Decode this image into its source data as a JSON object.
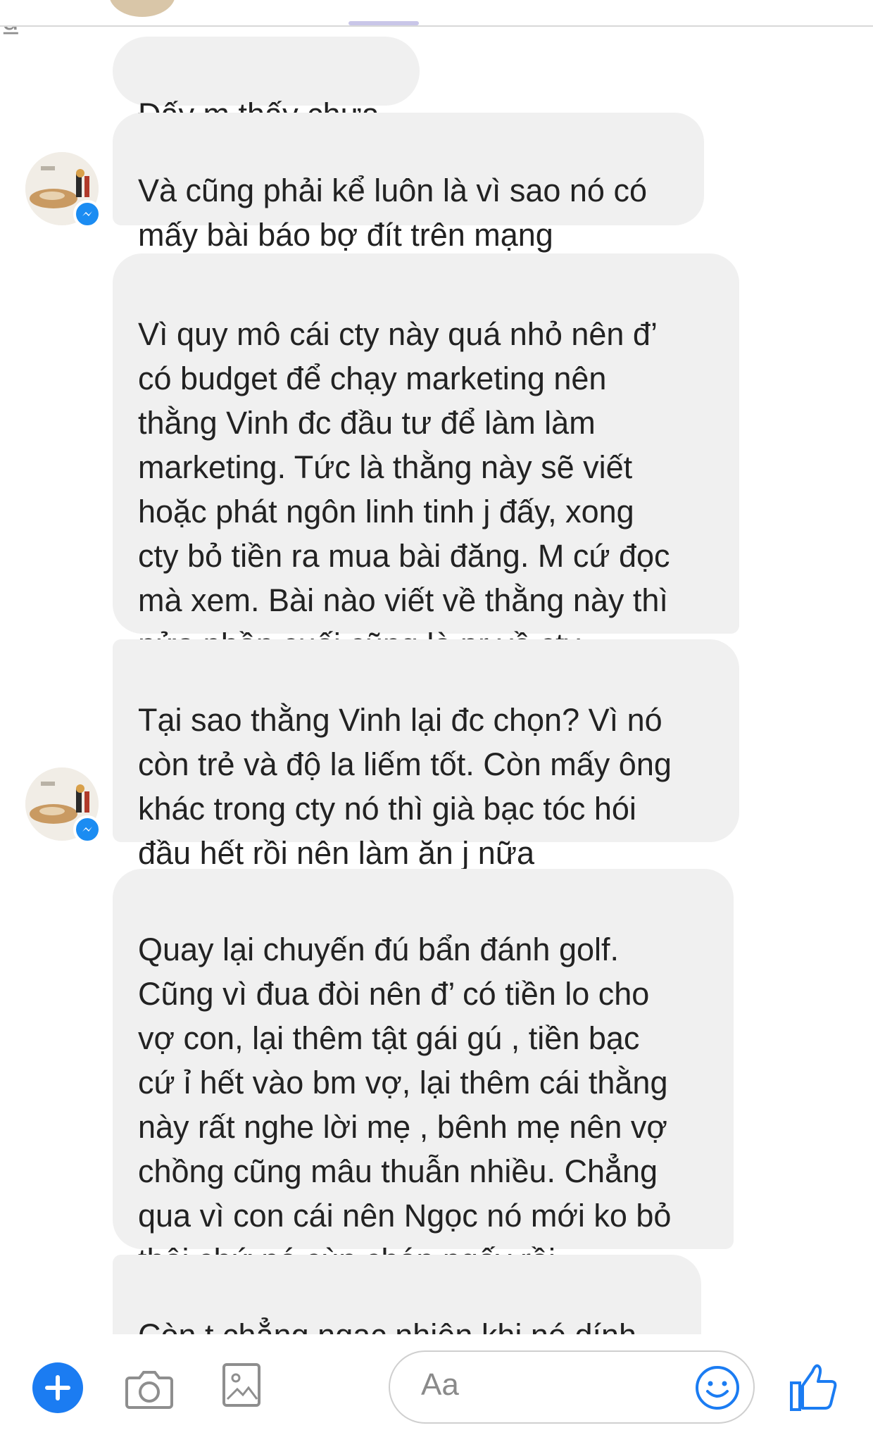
{
  "messages": [
    {
      "text": "Đấy m thấy chưa"
    },
    {
      "text": "Và cũng phải kể luôn là vì sao nó có\nmấy bài báo bợ đít trên mạng"
    },
    {
      "text": "Vì quy mô cái cty này quá nhỏ nên đ’\ncó budget để chạy marketing nên\nthằng Vinh đc đầu tư để làm làm\nmarketing. Tức là thằng này sẽ viết\nhoặc phát ngôn linh tinh j đấy, xong\ncty bỏ tiền ra mua bài đăng. M cứ đọc\nmà xem. Bài nào viết về thằng này thì\nnửa phần cuối cũng là pr về cty"
    },
    {
      "text": "Tại sao thằng Vinh lại đc chọn? Vì nó\ncòn trẻ và độ la liếm tốt. Còn mấy ông\nkhác trong cty nó thì già bạc tóc hói\nđầu hết rồi nên làm ăn j nữa"
    },
    {
      "text": "Quay lại chuyến đú bẩn đánh golf.\nCũng vì đua đòi nên đ’ có tiền lo cho\nvợ con, lại thêm tật gái gú , tiền bạc\ncứ ỉ hết vào bm vợ, lại thêm cái thằng\nnày rất nghe lời mẹ , bênh mẹ nên vợ\nchồng cũng mâu thuẫn nhiều. Chẳng\nqua vì con cái nên Ngọc nó mới ko bỏ\nthôi chứ nó cùn chán ngấy rồi."
    },
    {
      "text": "Còn t chẳng ngạc nhiên khi nó dính\nvào con X"
    }
  ],
  "composer": {
    "placeholder": "Aa",
    "dong_symbol": "₫",
    "icons": [
      "plus-icon",
      "camera-icon",
      "image-icon",
      "dong-icon",
      "emoji-icon",
      "thumbs-up-icon"
    ]
  },
  "colors": {
    "bubble": "#f0f0f0",
    "accent": "#1b7cf2",
    "icon_gray": "#8e8e8e"
  }
}
